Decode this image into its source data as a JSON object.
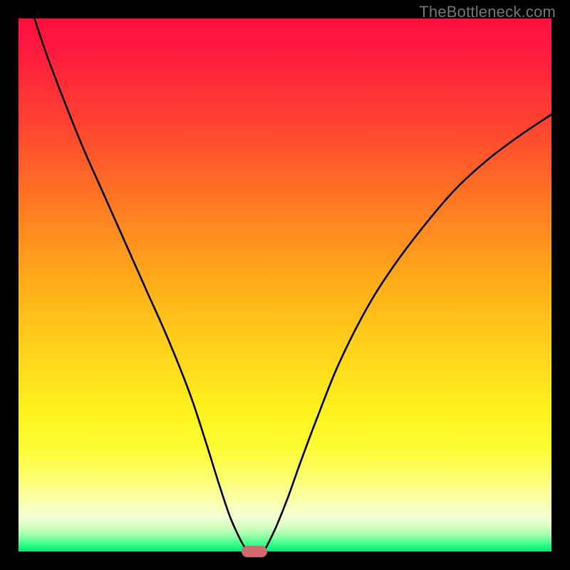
{
  "watermark": "TheBottleneck.com",
  "colors": {
    "gradient_stops": [
      {
        "offset": 0.0,
        "color": "#ff103e"
      },
      {
        "offset": 0.06,
        "color": "#ff1a3f"
      },
      {
        "offset": 0.2,
        "color": "#ff4330"
      },
      {
        "offset": 0.35,
        "color": "#ff7a22"
      },
      {
        "offset": 0.5,
        "color": "#ffae19"
      },
      {
        "offset": 0.62,
        "color": "#ffd21a"
      },
      {
        "offset": 0.73,
        "color": "#fef01e"
      },
      {
        "offset": 0.8,
        "color": "#fdfc2e"
      },
      {
        "offset": 0.86,
        "color": "#fcff6c"
      },
      {
        "offset": 0.905,
        "color": "#faffad"
      },
      {
        "offset": 0.935,
        "color": "#f2ffd6"
      },
      {
        "offset": 0.955,
        "color": "#d2ffc3"
      },
      {
        "offset": 0.97,
        "color": "#9affa7"
      },
      {
        "offset": 0.985,
        "color": "#3dff8b"
      },
      {
        "offset": 1.0,
        "color": "#00e876"
      }
    ],
    "curve": "#000000",
    "marker": "#cf6b6a",
    "background": "#000000"
  },
  "chart_data": {
    "type": "line",
    "title": "",
    "xlabel": "",
    "ylabel": "",
    "xlim": [
      0,
      100
    ],
    "ylim": [
      0,
      100
    ],
    "grid": false,
    "series": [
      {
        "name": "left-branch",
        "x": [
          3,
          5,
          8,
          12,
          16,
          20,
          24,
          28,
          32,
          35,
          37.5,
          39.5,
          41,
          42,
          42.8
        ],
        "y": [
          100,
          94,
          86,
          76,
          67,
          58,
          49,
          40,
          30,
          21,
          13,
          7,
          3.5,
          1.5,
          0.3
        ]
      },
      {
        "name": "right-branch",
        "x": [
          46.2,
          47,
          48.5,
          50.5,
          53,
          56,
          60,
          65,
          70,
          76,
          82,
          88,
          94,
          100
        ],
        "y": [
          0.3,
          1.8,
          5,
          10,
          17,
          25,
          35,
          45,
          53,
          61,
          68,
          73.5,
          78,
          82
        ]
      }
    ],
    "marker": {
      "x": 44.3,
      "y": 0.0,
      "width_pct": 4.8,
      "height_pct": 2.1
    }
  }
}
